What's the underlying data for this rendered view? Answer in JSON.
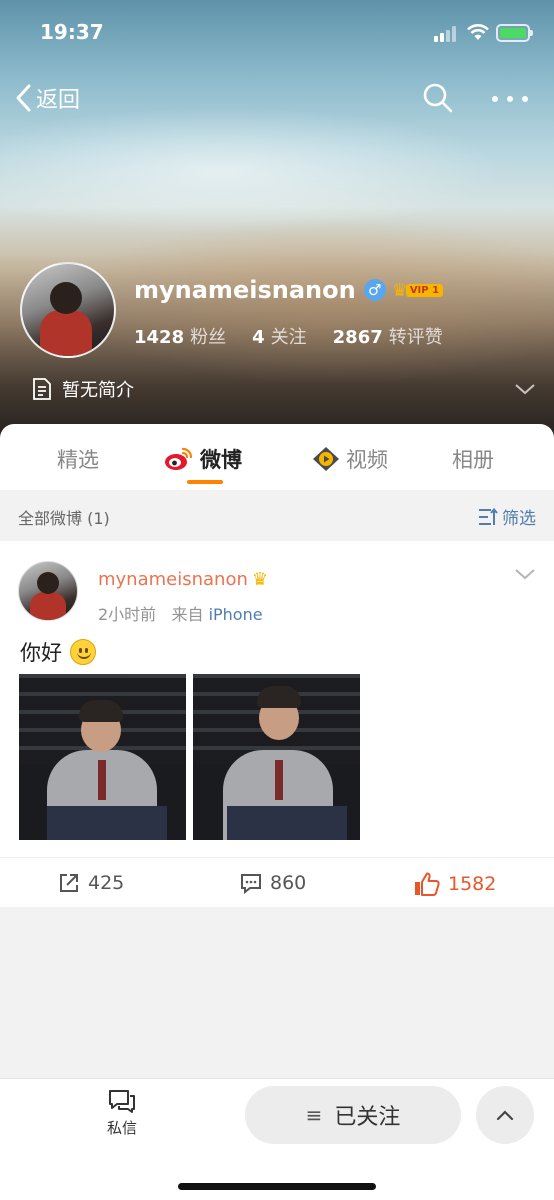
{
  "status": {
    "time": "19:37"
  },
  "nav": {
    "back_label": "返回"
  },
  "profile": {
    "username": "mynameisnanon",
    "gender_symbol": "♂",
    "vip_label": "VIP 1",
    "fans_count": "1428",
    "fans_label": "粉丝",
    "following_count": "4",
    "following_label": "关注",
    "reposts_likes_count": "2867",
    "reposts_likes_label": "转评赞",
    "bio": "暂无简介"
  },
  "tabs": [
    {
      "label": "精选"
    },
    {
      "label": "微博"
    },
    {
      "label": "视频"
    },
    {
      "label": "相册"
    }
  ],
  "filter": {
    "title": "全部微博 (1)",
    "button_label": "筛选"
  },
  "post": {
    "username": "mynameisnanon",
    "time_ago": "2小时前",
    "source_prefix": "来自",
    "source": "iPhone",
    "text": "你好",
    "reposts": "425",
    "comments": "860",
    "likes": "1582"
  },
  "bottom": {
    "dm_label": "私信",
    "follow_label": "已关注"
  },
  "colors": {
    "accent_orange": "#ff8200",
    "username_orange": "#eb7350",
    "link_blue": "#507daf",
    "like_red": "#e8562a"
  }
}
